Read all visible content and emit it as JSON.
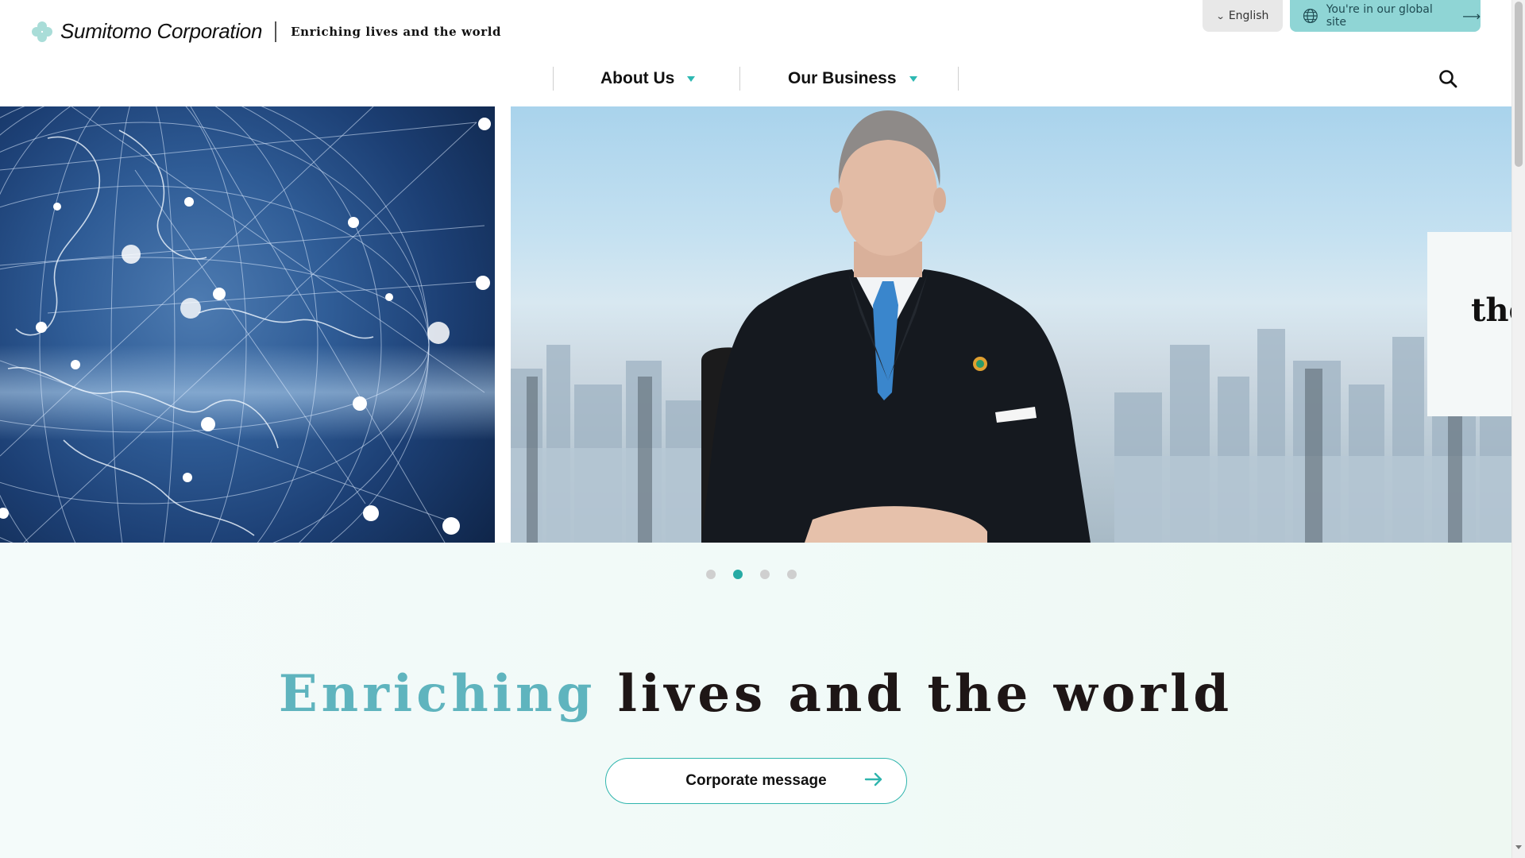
{
  "header": {
    "logo_name": "Sumitomo Corporation",
    "logo_tagline": "Enriching lives and the world",
    "language_label": "English",
    "global_site_label": "You're in our global site",
    "nav": [
      {
        "label": "About Us"
      },
      {
        "label": "Our Business"
      }
    ],
    "search_icon": "search-icon"
  },
  "hero": {
    "slide_text_fragment": "the",
    "carousel_dots": 4,
    "active_dot": 2
  },
  "main": {
    "tagline_accent": "Enriching",
    "tagline_rest": "lives and the world",
    "corporate_button_label": "Corporate message"
  },
  "colors": {
    "accent": "#2db8b2",
    "global_button": "#8fd5d5",
    "tagline_accent": "#5fb4be",
    "text": "#1e1616"
  }
}
